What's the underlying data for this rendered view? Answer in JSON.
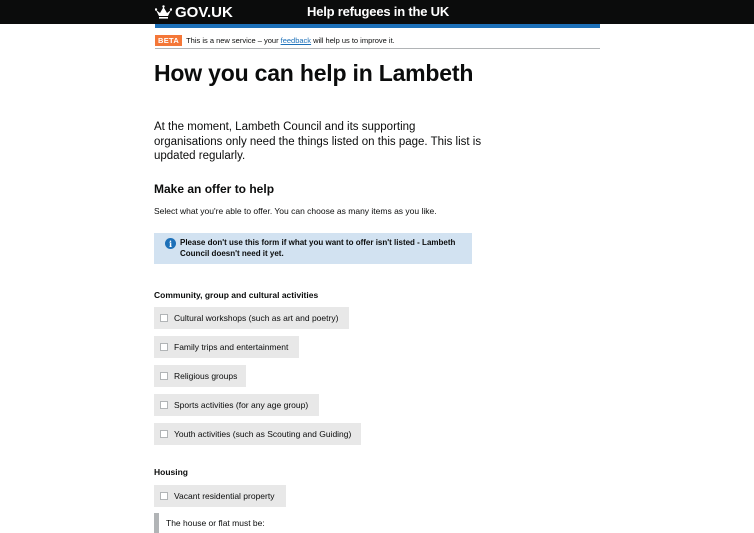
{
  "header": {
    "logo_text": "GOV.UK",
    "service_name": "Help refugees in the UK",
    "brand_color": "#0b0c0c",
    "accent_color": "#1d70b8"
  },
  "phase_banner": {
    "tag": "BETA",
    "text_before": "This is a new service – your",
    "link": "feedback",
    "text_after": "will help us to improve it.",
    "tag_color": "#f47738"
  },
  "page": {
    "title": "How you can help in Lambeth",
    "lead": "At the moment, Lambeth Council and its supporting organisations only need the things listed on this page. This list is updated regularly.",
    "section_heading": "Make an offer to help",
    "hint": "Select what you're able to offer. You can choose as many items as you like.",
    "notice": "Please don't use this form if what you want to offer isn't listed - Lambeth Council doesn't need it yet.",
    "notice_icon": "info-icon"
  },
  "groups": [
    {
      "legend": "Community, group and cultural activities",
      "options": [
        "Cultural workshops (such as art and poetry)",
        "Family trips and entertainment",
        "Religious groups",
        "Sports activities (for any age group)",
        "Youth activities (such as Scouting and Guiding)"
      ]
    },
    {
      "legend": "Housing",
      "options": [
        "Vacant residential property"
      ],
      "conditional_text": "The house or flat must be:"
    }
  ]
}
